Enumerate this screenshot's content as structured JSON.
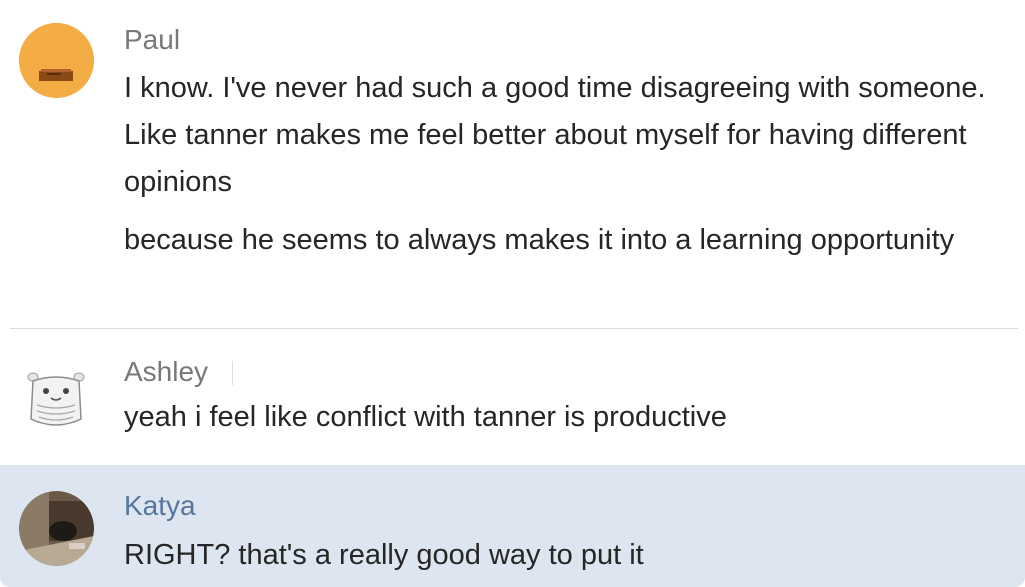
{
  "messages": [
    {
      "author": "Paul",
      "avatar_icon": "mail-envelope-avatar-icon",
      "avatar_color": "#f4ac45",
      "lines": [
        "I know. I've never had such a good time disagreeing with someone. Like tanner makes me feel better about myself for having different opinions",
        "because he seems to always makes it into a learning opportunity"
      ]
    },
    {
      "author": "Ashley",
      "avatar_icon": "robot-creature-avatar-icon",
      "lines": [
        "yeah i feel like conflict with tanner is productive"
      ]
    },
    {
      "author": "Katya",
      "avatar_icon": "photo-avatar-icon",
      "author_color": "#56769c",
      "highlight_color": "#dde6f0",
      "lines": [
        "RIGHT? that's a really good way to put it"
      ]
    }
  ]
}
